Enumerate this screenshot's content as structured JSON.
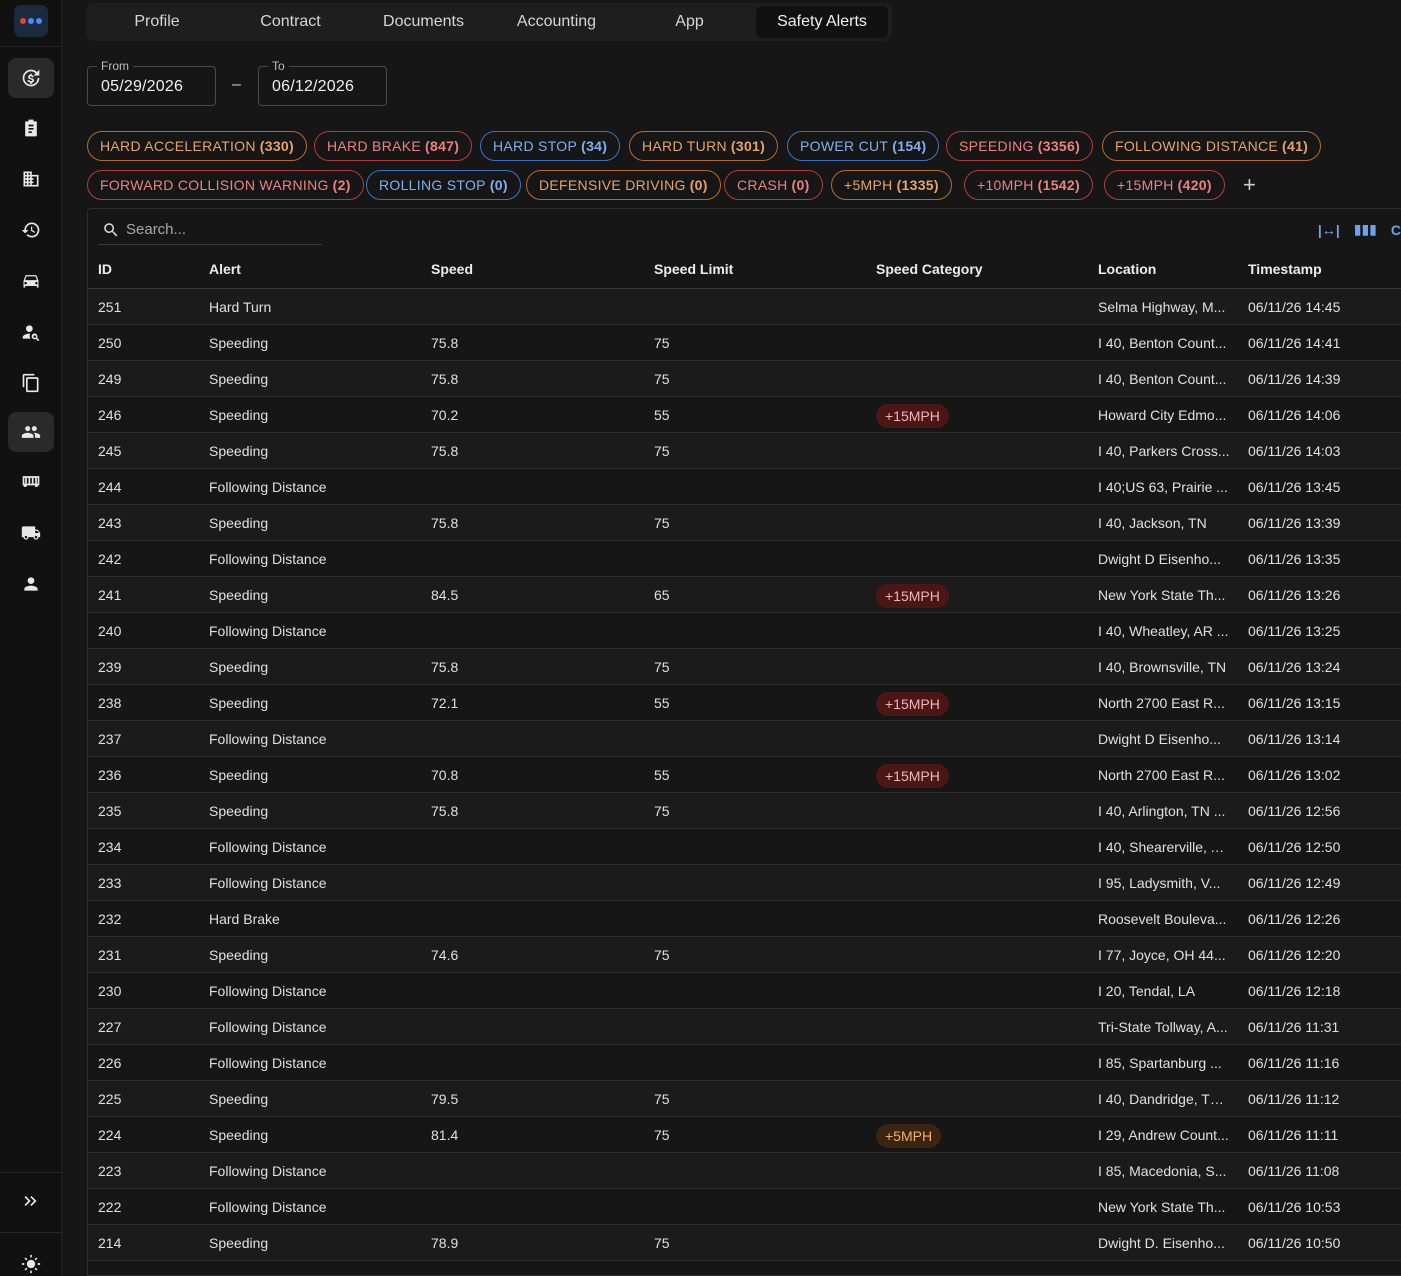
{
  "sidebar": {
    "logo_icon": "app-logo-icon",
    "items": [
      {
        "icon": "billing-icon",
        "active": true
      },
      {
        "icon": "clipboard-icon",
        "active": false
      },
      {
        "icon": "building-icon",
        "active": false
      },
      {
        "icon": "history-icon",
        "active": false
      },
      {
        "icon": "vehicle-search-icon",
        "active": false
      },
      {
        "icon": "user-search-icon",
        "active": false
      },
      {
        "icon": "copy-icon",
        "active": false
      },
      {
        "icon": "group-icon",
        "active": true
      },
      {
        "icon": "trailer-icon",
        "active": false
      },
      {
        "icon": "truck-icon",
        "active": false
      },
      {
        "icon": "person-icon",
        "active": false
      }
    ],
    "expand_icon": "double-chevron-right-icon",
    "theme_icon": "sun-icon"
  },
  "tabs": [
    "Profile",
    "Contract",
    "Documents",
    "Accounting",
    "App",
    "Safety Alerts"
  ],
  "active_tab": "Safety Alerts",
  "date_range": {
    "from_label": "From",
    "from_value": "05/29/2026",
    "separator": "–",
    "to_label": "To",
    "to_value": "06/12/2026"
  },
  "filters": [
    {
      "label": "HARD ACCELERATION",
      "count": "(330)",
      "color": "orange"
    },
    {
      "label": "HARD BRAKE",
      "count": "(847)",
      "color": "red"
    },
    {
      "label": "HARD STOP",
      "count": "(34)",
      "color": "blue"
    },
    {
      "label": "HARD TURN",
      "count": "(301)",
      "color": "orange"
    },
    {
      "label": "POWER CUT",
      "count": "(154)",
      "color": "blue"
    },
    {
      "label": "SPEEDING",
      "count": "(3356)",
      "color": "red"
    },
    {
      "label": "FOLLOWING DISTANCE",
      "count": "(41)",
      "color": "orange"
    },
    {
      "label": "FORWARD COLLISION WARNING",
      "count": "(2)",
      "color": "red"
    },
    {
      "label": "ROLLING STOP",
      "count": "(0)",
      "color": "blue"
    },
    {
      "label": "DEFENSIVE DRIVING",
      "count": "(0)",
      "color": "orange"
    },
    {
      "label": "CRASH",
      "count": "(0)",
      "color": "red"
    },
    {
      "label": "+5MPH",
      "count": "(1335)",
      "color": "orange"
    },
    {
      "label": "+10MPH",
      "count": "(1542)",
      "color": "red"
    },
    {
      "label": "+15MPH",
      "count": "(420)",
      "color": "red"
    }
  ],
  "add_filter": "+",
  "table": {
    "search_placeholder": "Search...",
    "toolbar_partial_label": "C",
    "columns": [
      "ID",
      "Alert",
      "Speed",
      "Speed Limit",
      "Speed Category",
      "Location",
      "Timestamp"
    ],
    "rows": [
      {
        "id": "251",
        "alert": "Hard Turn",
        "speed": "",
        "limit": "",
        "category": "",
        "location": "Selma Highway, M...",
        "timestamp": "06/11/26 14:45"
      },
      {
        "id": "250",
        "alert": "Speeding",
        "speed": "75.8",
        "limit": "75",
        "category": "",
        "location": "I 40, Benton Count...",
        "timestamp": "06/11/26 14:41"
      },
      {
        "id": "249",
        "alert": "Speeding",
        "speed": "75.8",
        "limit": "75",
        "category": "",
        "location": "I 40, Benton Count...",
        "timestamp": "06/11/26 14:39"
      },
      {
        "id": "246",
        "alert": "Speeding",
        "speed": "70.2",
        "limit": "55",
        "category": "+15MPH",
        "location": "Howard City Edmo...",
        "timestamp": "06/11/26 14:06"
      },
      {
        "id": "245",
        "alert": "Speeding",
        "speed": "75.8",
        "limit": "75",
        "category": "",
        "location": "I 40, Parkers Cross...",
        "timestamp": "06/11/26 14:03"
      },
      {
        "id": "244",
        "alert": "Following Distance",
        "speed": "",
        "limit": "",
        "category": "",
        "location": "I 40;US 63, Prairie ...",
        "timestamp": "06/11/26 13:45"
      },
      {
        "id": "243",
        "alert": "Speeding",
        "speed": "75.8",
        "limit": "75",
        "category": "",
        "location": "I 40, Jackson, TN",
        "timestamp": "06/11/26 13:39"
      },
      {
        "id": "242",
        "alert": "Following Distance",
        "speed": "",
        "limit": "",
        "category": "",
        "location": "Dwight D Eisenho...",
        "timestamp": "06/11/26 13:35"
      },
      {
        "id": "241",
        "alert": "Speeding",
        "speed": "84.5",
        "limit": "65",
        "category": "+15MPH",
        "location": "New York State Th...",
        "timestamp": "06/11/26 13:26"
      },
      {
        "id": "240",
        "alert": "Following Distance",
        "speed": "",
        "limit": "",
        "category": "",
        "location": "I 40, Wheatley, AR ...",
        "timestamp": "06/11/26 13:25"
      },
      {
        "id": "239",
        "alert": "Speeding",
        "speed": "75.8",
        "limit": "75",
        "category": "",
        "location": "I 40, Brownsville, TN",
        "timestamp": "06/11/26 13:24"
      },
      {
        "id": "238",
        "alert": "Speeding",
        "speed": "72.1",
        "limit": "55",
        "category": "+15MPH",
        "location": "North 2700 East R...",
        "timestamp": "06/11/26 13:15"
      },
      {
        "id": "237",
        "alert": "Following Distance",
        "speed": "",
        "limit": "",
        "category": "",
        "location": "Dwight D Eisenho...",
        "timestamp": "06/11/26 13:14"
      },
      {
        "id": "236",
        "alert": "Speeding",
        "speed": "70.8",
        "limit": "55",
        "category": "+15MPH",
        "location": "North 2700 East R...",
        "timestamp": "06/11/26 13:02"
      },
      {
        "id": "235",
        "alert": "Speeding",
        "speed": "75.8",
        "limit": "75",
        "category": "",
        "location": "I 40, Arlington, TN ...",
        "timestamp": "06/11/26 12:56"
      },
      {
        "id": "234",
        "alert": "Following Distance",
        "speed": "",
        "limit": "",
        "category": "",
        "location": "I 40, Shearerville, A...",
        "timestamp": "06/11/26 12:50"
      },
      {
        "id": "233",
        "alert": "Following Distance",
        "speed": "",
        "limit": "",
        "category": "",
        "location": "I 95, Ladysmith, V...",
        "timestamp": "06/11/26 12:49"
      },
      {
        "id": "232",
        "alert": "Hard Brake",
        "speed": "",
        "limit": "",
        "category": "",
        "location": "Roosevelt Bouleva...",
        "timestamp": "06/11/26 12:26"
      },
      {
        "id": "231",
        "alert": "Speeding",
        "speed": "74.6",
        "limit": "75",
        "category": "",
        "location": "I 77, Joyce, OH 44...",
        "timestamp": "06/11/26 12:20"
      },
      {
        "id": "230",
        "alert": "Following Distance",
        "speed": "",
        "limit": "",
        "category": "",
        "location": "I 20, Tendal, LA",
        "timestamp": "06/11/26 12:18"
      },
      {
        "id": "227",
        "alert": "Following Distance",
        "speed": "",
        "limit": "",
        "category": "",
        "location": "Tri-State Tollway, A...",
        "timestamp": "06/11/26 11:31"
      },
      {
        "id": "226",
        "alert": "Following Distance",
        "speed": "",
        "limit": "",
        "category": "",
        "location": "I 85, Spartanburg ...",
        "timestamp": "06/11/26 11:16"
      },
      {
        "id": "225",
        "alert": "Speeding",
        "speed": "79.5",
        "limit": "75",
        "category": "",
        "location": "I 40, Dandridge, TN...",
        "timestamp": "06/11/26 11:12"
      },
      {
        "id": "224",
        "alert": "Speeding",
        "speed": "81.4",
        "limit": "75",
        "category": "+5MPH",
        "location": "I 29, Andrew Count...",
        "timestamp": "06/11/26 11:11"
      },
      {
        "id": "223",
        "alert": "Following Distance",
        "speed": "",
        "limit": "",
        "category": "",
        "location": "I 85, Macedonia, S...",
        "timestamp": "06/11/26 11:08"
      },
      {
        "id": "222",
        "alert": "Following Distance",
        "speed": "",
        "limit": "",
        "category": "",
        "location": "New York State Th...",
        "timestamp": "06/11/26 10:53"
      },
      {
        "id": "214",
        "alert": "Speeding",
        "speed": "78.9",
        "limit": "75",
        "category": "",
        "location": "Dwight D. Eisenho...",
        "timestamp": "06/11/26 10:50"
      }
    ]
  }
}
